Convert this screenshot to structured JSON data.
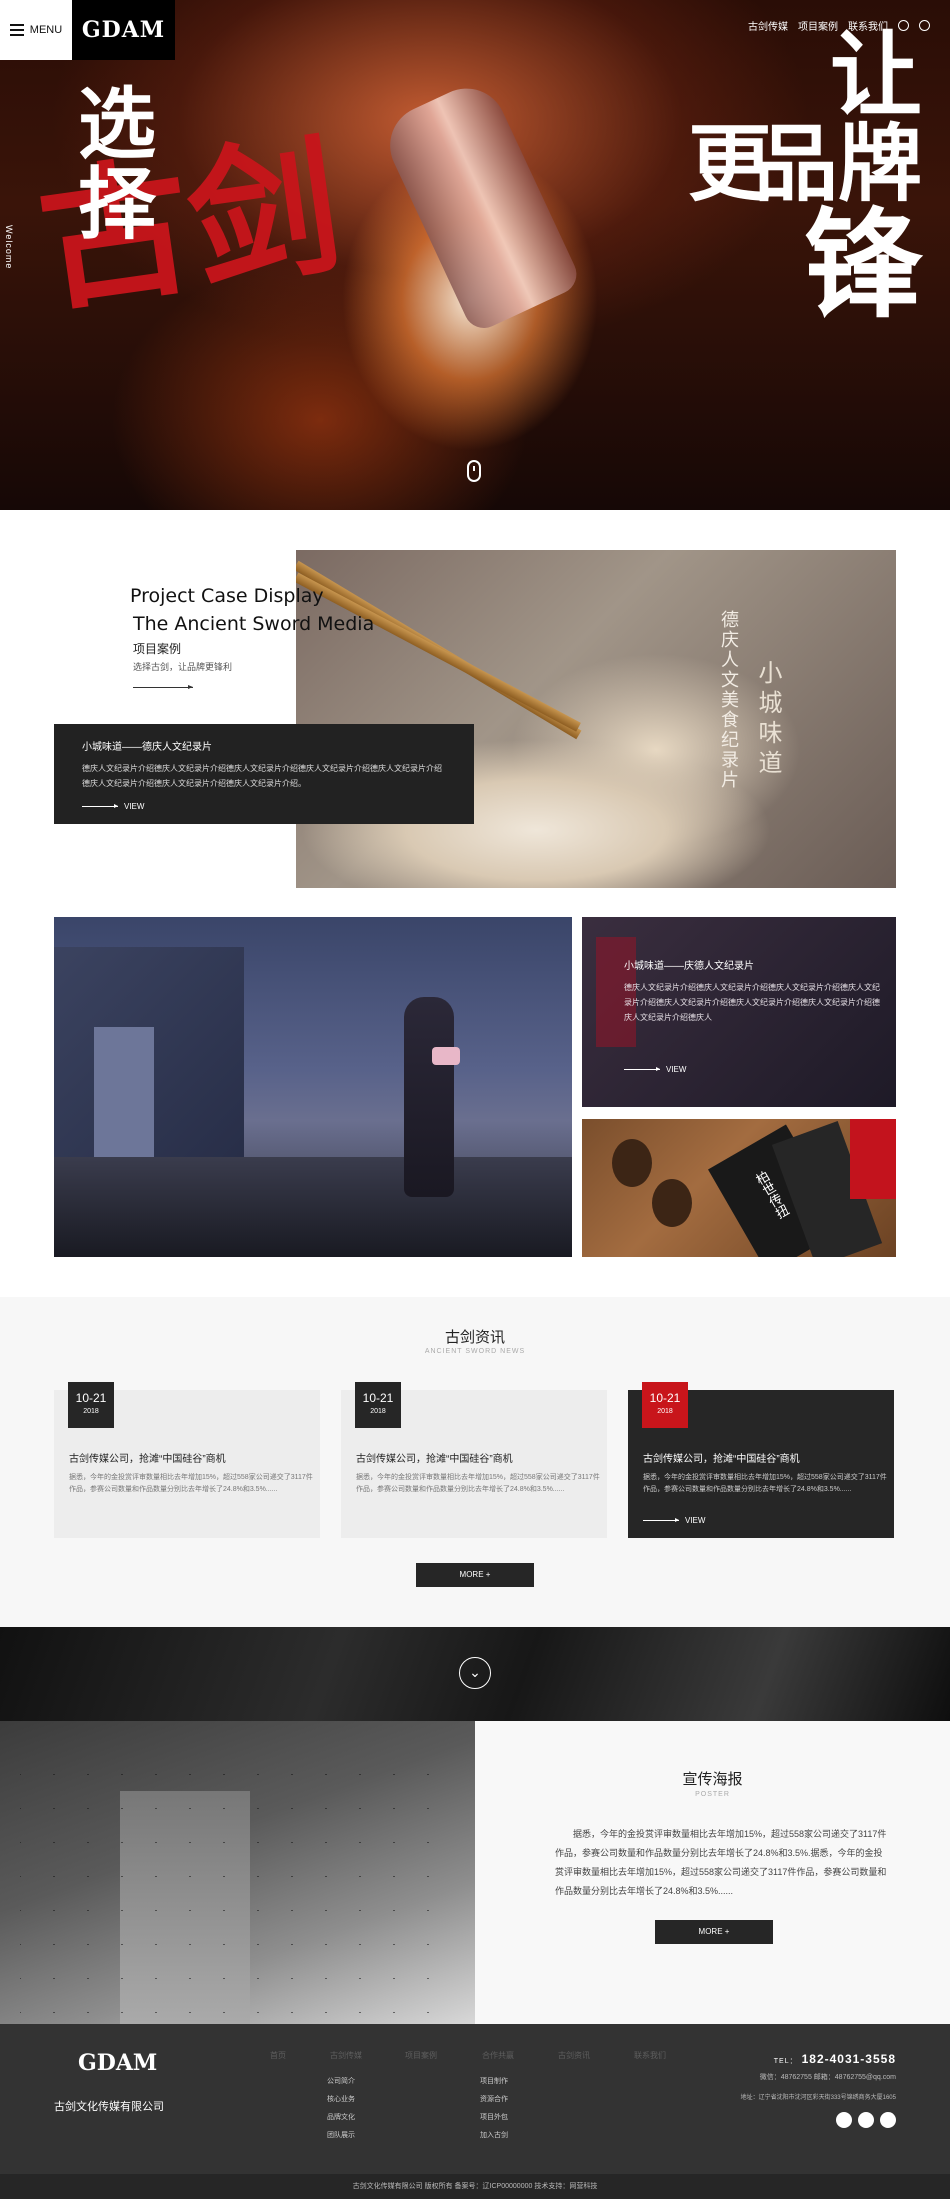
{
  "header": {
    "menu_label": "MENU",
    "logo": "GDAM",
    "nav": [
      "古剑传媒",
      "项目案例",
      "联系我们"
    ]
  },
  "hero": {
    "welcome": "Welcome",
    "left_text": "选择",
    "red_text": "古剑",
    "right_line1": "让",
    "right_line2": "品牌",
    "right_line3": "更",
    "right_line4": "锋"
  },
  "case": {
    "title_en1": "Project Case Display",
    "title_en2": "The Ancient Sword Media",
    "title_cn": "项目案例",
    "slogan": "选择古剑，让品牌更锋利",
    "img_vertical1": "德庆人文美食纪录片",
    "img_vertical2": "小城味道",
    "card": {
      "title": "小城味道——德庆人文纪录片",
      "desc": "德庆人文纪录片介绍德庆人文纪录片介绍德庆人文纪录片介绍德庆人文纪录片介绍德庆人文纪录片介绍德庆人文纪录片介绍德庆人文纪录片介绍德庆人文纪录片介绍。",
      "view": "VIEW"
    },
    "card2": {
      "title": "小城味道——庆德人文纪录片",
      "desc": "德庆人文纪录片介绍德庆人文纪录片介绍德庆人文纪录片介绍德庆人文纪录片介绍德庆人文纪录片介绍德庆人文纪录片介绍德庆人文纪录片介绍德庆人文纪录片介绍德庆人",
      "view": "VIEW"
    },
    "pack_text": "柏世传扭"
  },
  "news": {
    "title": "古剑资讯",
    "subtitle": "ANCIENT SWORD NEWS",
    "items": [
      {
        "day": "10-21",
        "year": "2018",
        "title": "古剑传媒公司，抢滩“中国硅谷”商机",
        "desc": "据悉，今年的金投赏评审数量相比去年增加15%，超过558家公司递交了3117件作品，参赛公司数量和作品数量分别比去年增长了24.8%和3.5%......"
      },
      {
        "day": "10-21",
        "year": "2018",
        "title": "古剑传媒公司，抢滩“中国硅谷”商机",
        "desc": "据悉，今年的金投赏评审数量相比去年增加15%，超过558家公司递交了3117件作品，参赛公司数量和作品数量分别比去年增长了24.8%和3.5%......"
      },
      {
        "day": "10-21",
        "year": "2018",
        "title": "古剑传媒公司，抢滩“中国硅谷”商机",
        "desc": "据悉，今年的金投赏评审数量相比去年增加15%，超过558家公司递交了3117件作品，参赛公司数量和作品数量分别比去年增长了24.8%和3.5%......",
        "view": "VIEW"
      }
    ],
    "more": "MORE +"
  },
  "poster": {
    "title": "宣传海报",
    "subtitle": "POSTER",
    "desc": "据悉，今年的金投赏评审数量相比去年增加15%，超过558家公司递交了3117件作品，参赛公司数量和作品数量分别比去年增长了24.8%和3.5%.据悉，今年的金投赏评审数量相比去年增加15%，超过558家公司递交了3117件作品，参赛公司数量和作品数量分别比去年增长了24.8%和3.5%......",
    "more": "MORE +"
  },
  "footer": {
    "logo": "GDAM",
    "company": "古剑文化传媒有限公司",
    "nav": [
      "首页",
      "古剑传媒",
      "项目案例",
      "合作共赢",
      "古剑资讯",
      "联系我们"
    ],
    "links_col1": [
      "公司简介",
      "核心业务",
      "品牌文化",
      "团队展示"
    ],
    "links_col2": [
      "项目制作",
      "资源合作",
      "项目外包",
      "加入古剑"
    ],
    "tel_label": "TEL：",
    "tel": "182-4031-3558",
    "contact": "微信：48762755    邮箱：48762755@qq.com",
    "address": "地址：辽宁省沈阳市沈河区彩天街333号锦绣商务大厦1605",
    "copyright": "古剑文化传媒有限公司  版权所有      备案号：辽ICP00000000      技术支持：网营科技"
  }
}
